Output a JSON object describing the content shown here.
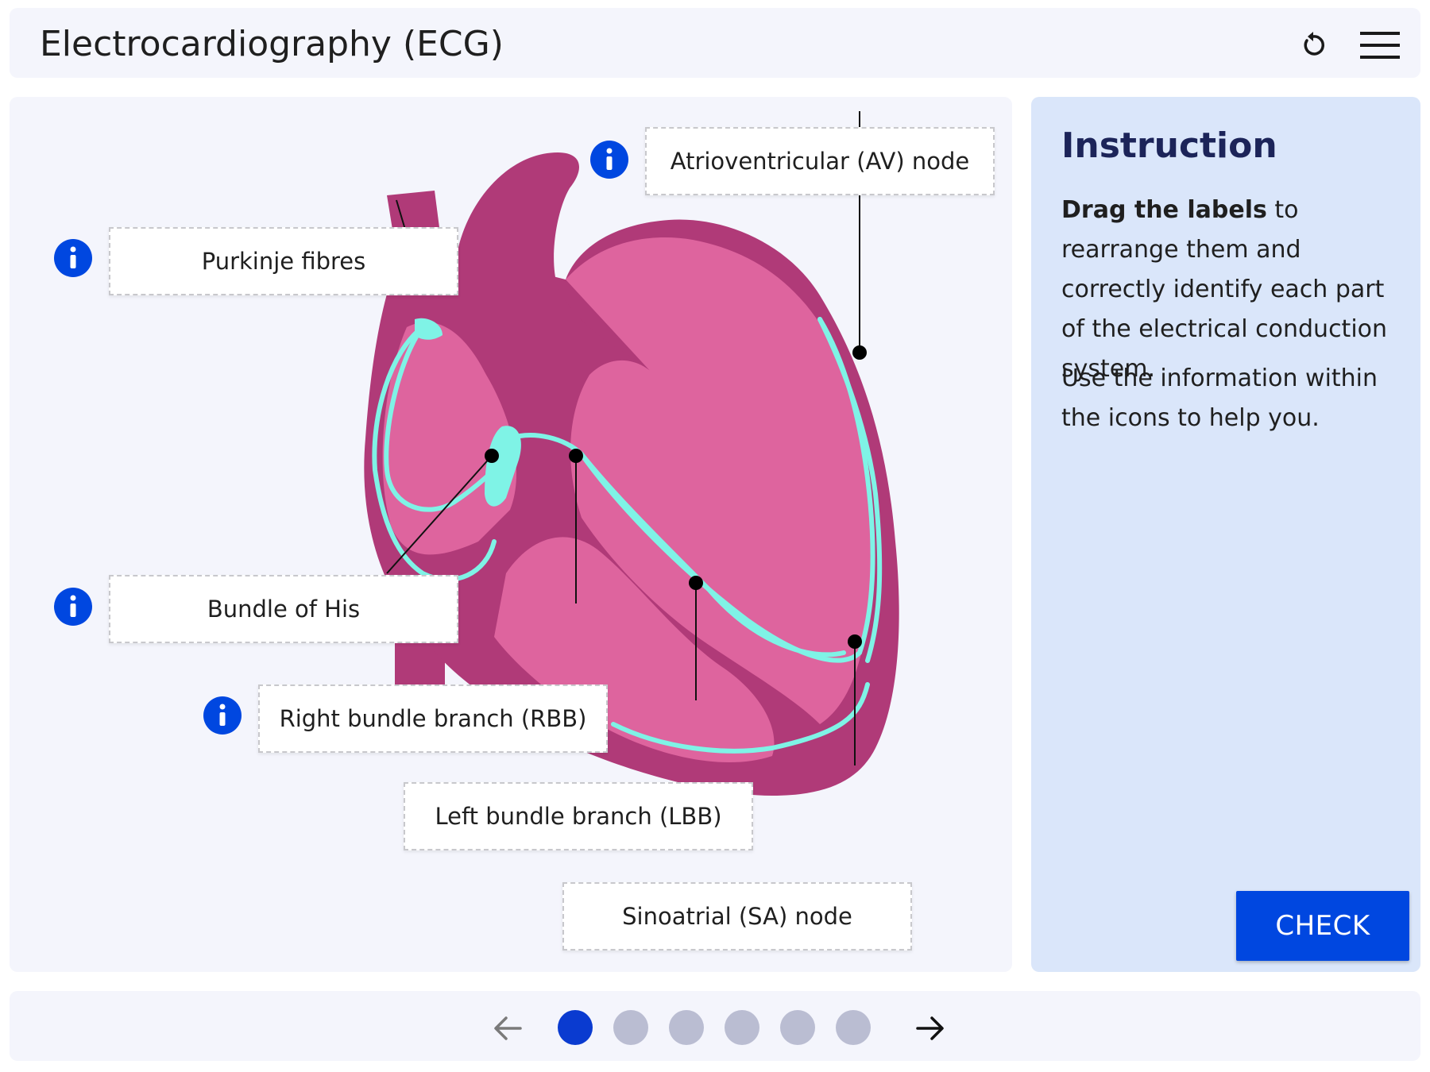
{
  "app": {
    "title": "Electrocardiography (ECG)"
  },
  "header": {
    "reset_icon": "reset-icon",
    "menu_icon": "hamburger-menu-icon"
  },
  "labels": [
    "Atrioventricular (AV) node",
    "Purkinje fibres",
    "Bundle of His",
    "Right bundle branch (RBB)",
    "Left bundle branch (LBB)",
    "Sinoatrial (SA) node"
  ],
  "info_icon": "info-icon",
  "instruction": {
    "title": "Instruction",
    "p1_bold": "Drag the labels",
    "p1_rest": " to rearrange them and correctly identify each part of the electrical conduction system.",
    "p2": "Use the information within the icons to help you.",
    "check_label": "CHECK"
  },
  "pagination": {
    "total": 6,
    "current": 1
  },
  "colors": {
    "heart_outer": "#b03a78",
    "heart_inner": "#de649e",
    "conduction": "#7ff3e6",
    "accent": "#0047e0",
    "dot_active": "#0a3bd0",
    "dot_inactive": "#babdd2"
  }
}
